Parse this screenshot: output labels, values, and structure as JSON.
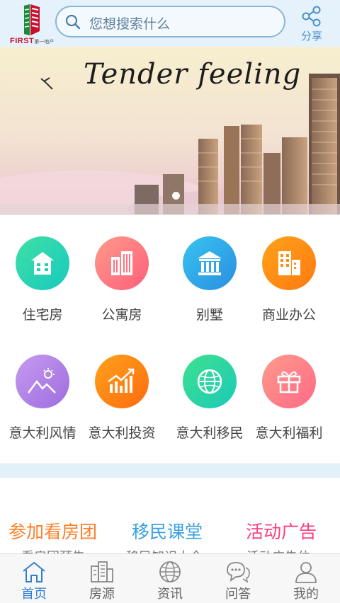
{
  "header": {
    "logo_text": "FIRST",
    "logo_subtext": "第一地产",
    "search_placeholder": "您想搜索什么",
    "share_label": "分享"
  },
  "banner": {
    "title": "Tender feeling",
    "slide_count": 1,
    "active_slide": 1
  },
  "categories": [
    {
      "label": "住宅房",
      "icon": "house-icon",
      "color_from": "#3fe0a4",
      "color_to": "#18c9c0"
    },
    {
      "label": "公寓房",
      "icon": "apartment-icon",
      "color_from": "#ff8a8a",
      "color_to": "#ff5f7a"
    },
    {
      "label": "别墅",
      "icon": "villa-icon",
      "color_from": "#37c3f0",
      "color_to": "#2a8fe0"
    },
    {
      "label": "商业办公",
      "icon": "office-icon",
      "color_from": "#ffa21a",
      "color_to": "#ff7a10"
    },
    {
      "label": "意大利风情",
      "icon": "landscape-icon",
      "color_from": "#b889e8",
      "color_to": "#9d6ddf"
    },
    {
      "label": "意大利投资",
      "icon": "investment-chart-icon",
      "color_from": "#ff9c1c",
      "color_to": "#ff6a10"
    },
    {
      "label": "意大利移民",
      "icon": "globe-icon",
      "color_from": "#3fe08e",
      "color_to": "#1ccab8"
    },
    {
      "label": "意大利福利",
      "icon": "gift-icon",
      "color_from": "#ff8e8e",
      "color_to": "#ff6a88"
    }
  ],
  "links": [
    {
      "label": "参加看房团",
      "sub": "看房团预告",
      "color": "#ff7e26"
    },
    {
      "label": "移民课堂",
      "sub": "移民知识大全",
      "color": "#3aa0e0"
    },
    {
      "label": "活动广告",
      "sub": "活动广告位",
      "color": "#ff3f7a"
    }
  ],
  "nav": [
    {
      "label": "首页",
      "icon": "home-icon",
      "active": true
    },
    {
      "label": "房源",
      "icon": "building-icon",
      "active": false
    },
    {
      "label": "资讯",
      "icon": "globe-news-icon",
      "active": false
    },
    {
      "label": "问答",
      "icon": "chat-icon",
      "active": false
    },
    {
      "label": "我的",
      "icon": "user-icon",
      "active": false
    }
  ],
  "colors": {
    "accent": "#2f7fd0",
    "header_bg": "#e6f2fb",
    "logo_red": "#c8102e",
    "logo_green": "#1a8a3a"
  }
}
